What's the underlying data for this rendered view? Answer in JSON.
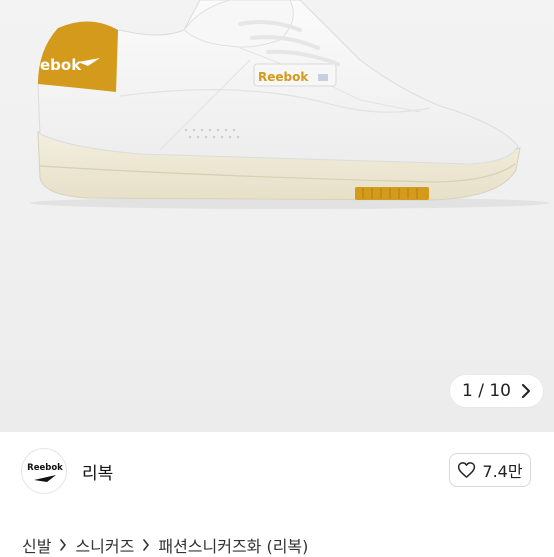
{
  "gallery": {
    "counter_text": "1 / 10",
    "shoe_logo_text": "Reebok",
    "heel_logo_text": "ebok"
  },
  "brand": {
    "logo_text": "Reebok",
    "name": "리복"
  },
  "like": {
    "count": "7.4만"
  },
  "breadcrumb": {
    "items": [
      "신발",
      "스니커즈",
      "패션스니커즈화 (리복)"
    ]
  },
  "colors": {
    "accent_mustard": "#d39a1c",
    "gallery_bg": "#efefef"
  }
}
